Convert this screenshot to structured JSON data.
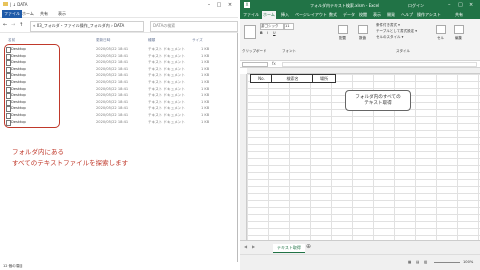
{
  "explorer": {
    "title": "| ↓ DATA",
    "ribbon_tabs": [
      "ファイル",
      "ホーム",
      "共有",
      "表示"
    ],
    "address": "« 03_フォルダ・ファイル操作_フォルダ内 › DATA",
    "search_placeholder": "DATAの検索",
    "columns": {
      "name": "名前",
      "date": "更新日時",
      "type": "種類",
      "size": "サイズ"
    },
    "files": [
      {
        "name": "Desktop",
        "date": "2020/05/22 18:41",
        "type": "テキスト ドキュメント",
        "size": "1 KB"
      },
      {
        "name": "Desktop",
        "date": "2020/05/22 18:41",
        "type": "テキスト ドキュメント",
        "size": "1 KB"
      },
      {
        "name": "Desktop",
        "date": "2020/05/22 18:41",
        "type": "テキスト ドキュメント",
        "size": "1 KB"
      },
      {
        "name": "Desktop",
        "date": "2020/05/22 18:41",
        "type": "テキスト ドキュメント",
        "size": "1 KB"
      },
      {
        "name": "Desktop",
        "date": "2020/05/22 18:41",
        "type": "テキスト ドキュメント",
        "size": "1 KB"
      },
      {
        "name": "Desktop",
        "date": "2020/05/22 18:41",
        "type": "テキスト ドキュメント",
        "size": "1 KB"
      },
      {
        "name": "Desktop",
        "date": "2020/05/22 18:41",
        "type": "テキスト ドキュメント",
        "size": "1 KB"
      },
      {
        "name": "Desktop",
        "date": "2020/05/22 18:41",
        "type": "テキスト ドキュメント",
        "size": "1 KB"
      },
      {
        "name": "Desktop",
        "date": "2020/05/22 18:41",
        "type": "テキスト ドキュメント",
        "size": "1 KB"
      },
      {
        "name": "Desktop",
        "date": "2020/05/22 18:41",
        "type": "テキスト ドキュメント",
        "size": "1 KB"
      },
      {
        "name": "Desktop",
        "date": "2020/05/22 18:41",
        "type": "テキスト ドキュメント",
        "size": "1 KB"
      },
      {
        "name": "Desktop",
        "date": "2020/05/22 18:41",
        "type": "テキスト ドキュメント",
        "size": "1 KB"
      }
    ],
    "annotation_line1": "フォルダ内にある",
    "annotation_line2": "すべてのテキストファイルを探索します",
    "status": "12 個の項目"
  },
  "excel": {
    "title": "フォルダ内テキスト検索.xlsm - Excel",
    "user_label": "ログイン",
    "tabs": [
      "ファイル",
      "ホーム",
      "挿入",
      "ページレイアウト",
      "数式",
      "データ",
      "校閲",
      "表示",
      "開発",
      "ヘルプ",
      "操作アシスト",
      "共有"
    ],
    "ribbon": {
      "font_name": "游ゴシック",
      "font_size": "11",
      "align": "配置",
      "number": "数値",
      "cond_format": "条件付き書式 ▾",
      "table_format": "テーブルとして書式設定 ▾",
      "cell_styles": "セルのスタイル ▾",
      "cells": "セル",
      "edit": "編集",
      "clipboard": "クリップボード",
      "font_group": "フォント",
      "style_group": "スタイル"
    },
    "namebox": "",
    "headers": [
      "No.",
      "検索名",
      "場所"
    ],
    "button_line1": "フォルダ内のすべての",
    "button_line2": "テキスト取得",
    "sheet_tab": "テキスト取得",
    "zoom": "100%"
  },
  "colors": {
    "excel_green": "#217346",
    "annotation_red": "#c0392b",
    "explorer_blue": "#1e5aa8"
  }
}
